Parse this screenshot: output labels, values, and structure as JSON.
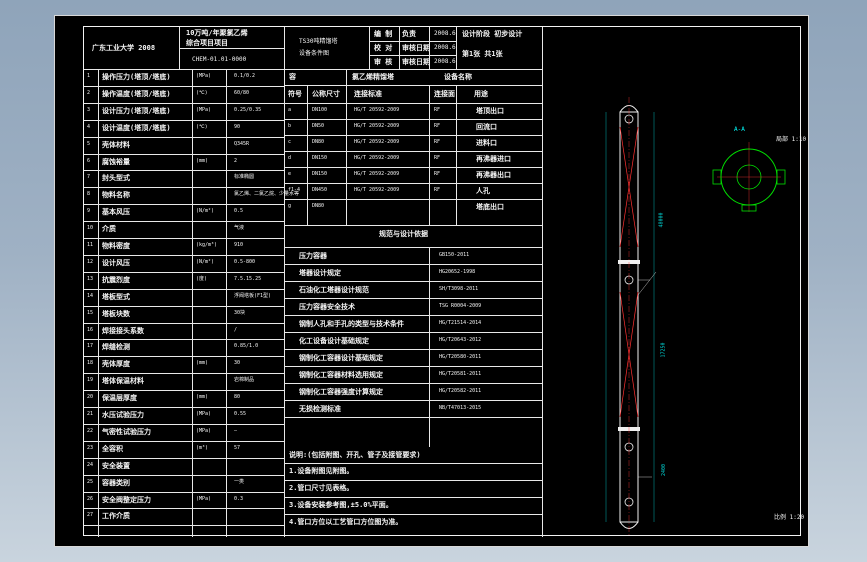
{
  "title_block": {
    "org": "广东工业大学 2008",
    "project_l1": "10万吨/年聚氯乙烯",
    "project_l2": "综合项目项目",
    "code": "CHEM-01.01-0000",
    "drawing_l1": "TS30吨精馏塔",
    "drawing_l2": "设备条件图",
    "roles": [
      {
        "role": "编  制",
        "date": "2008.6"
      },
      {
        "role": "校  对",
        "date": "2008.6"
      },
      {
        "role": "审  核",
        "date": "2008.6"
      }
    ],
    "names": [
      "负责",
      "审核日期",
      "审核日期"
    ],
    "stage": "设计阶段  初步设计",
    "scale_label": "比例  1:20",
    "sheet_no": "第1张  共1张"
  },
  "params": {
    "rows": [
      {
        "no": "1",
        "name": "操作压力(塔顶/塔底)",
        "unit": "MPa",
        "val": "0.1/0.2"
      },
      {
        "no": "2",
        "name": "操作温度(塔顶/塔底)",
        "unit": "℃",
        "val": "60/80"
      },
      {
        "no": "3",
        "name": "设计压力(塔顶/塔底)",
        "unit": "MPa",
        "val": "0.25/0.35"
      },
      {
        "no": "4",
        "name": "设计温度(塔顶/塔底)",
        "unit": "℃",
        "val": "90"
      },
      {
        "no": "5",
        "name": "壳体材料",
        "unit": "",
        "val": "Q345R"
      },
      {
        "no": "6",
        "name": "腐蚀裕量",
        "unit": "mm",
        "val": "2"
      },
      {
        "no": "7",
        "name": "封头型式",
        "unit": "",
        "val": "标准椭圆"
      },
      {
        "no": "8",
        "name": "物料名称",
        "unit": "",
        "val": "氯乙烯、二氯乙烷、少量水等"
      },
      {
        "no": "9",
        "name": "基本风压",
        "unit": "N/m²",
        "val": "0.5"
      },
      {
        "no": "10",
        "name": "介质",
        "unit": "",
        "val": "气液"
      },
      {
        "no": "11",
        "name": "物料密度",
        "unit": "kg/m³",
        "val": "910"
      },
      {
        "no": "12",
        "name": "设计风压",
        "unit": "N/m²",
        "val": "0.5-800"
      },
      {
        "no": "13",
        "name": "抗震烈度",
        "unit": "度",
        "val": "7.5.15.25"
      },
      {
        "no": "14",
        "name": "塔板型式",
        "unit": "",
        "val": "浮阀塔板(F1型)"
      },
      {
        "no": "15",
        "name": "塔板块数",
        "unit": "",
        "val": "30块"
      },
      {
        "no": "16",
        "name": "焊接接头系数",
        "unit": "",
        "val": "/"
      },
      {
        "no": "17",
        "name": "焊缝检测",
        "unit": "",
        "val": "0.85/1.0"
      },
      {
        "no": "18",
        "name": "壳体厚度",
        "unit": "mm",
        "val": "30"
      },
      {
        "no": "19",
        "name": "塔体保温材料",
        "unit": "",
        "val": "岩棉制品"
      },
      {
        "no": "20",
        "name": "保温层厚度",
        "unit": "mm",
        "val": "80"
      },
      {
        "no": "21",
        "name": "水压试验压力",
        "unit": "MPa",
        "val": "0.55"
      },
      {
        "no": "22",
        "name": "气密性试验压力",
        "unit": "MPa",
        "val": "—"
      },
      {
        "no": "23",
        "name": "全容积",
        "unit": "m³",
        "val": "57"
      },
      {
        "no": "24",
        "name": "安全装置",
        "unit": "",
        "val": ""
      },
      {
        "no": "25",
        "name": "容器类别",
        "unit": "",
        "val": "一类"
      },
      {
        "no": "26",
        "name": "安全阀整定压力",
        "unit": "MPa",
        "val": "0.3"
      },
      {
        "no": "27",
        "name": "工作介质",
        "unit": "",
        "val": ""
      }
    ]
  },
  "nozzles": {
    "headers": [
      "符号",
      "公称尺寸",
      "连接标准",
      "连接面",
      "用途"
    ],
    "top_label": "设备名称",
    "top_value": "氯乙烯精馏塔",
    "rows": [
      {
        "sym": "a",
        "dn": "DN100",
        "std": "HG/T 20592-2009",
        "face": "RF",
        "use": "塔顶出口"
      },
      {
        "sym": "b",
        "dn": "DN50",
        "std": "HG/T 20592-2009",
        "face": "RF",
        "use": "回流口"
      },
      {
        "sym": "c",
        "dn": "DN80",
        "std": "HG/T 20592-2009",
        "face": "RF",
        "use": "进料口"
      },
      {
        "sym": "d",
        "dn": "DN150",
        "std": "HG/T 20592-2009",
        "face": "RF",
        "use": "再沸器进口"
      },
      {
        "sym": "e",
        "dn": "DN150",
        "std": "HG/T 20592-2009",
        "face": "RF",
        "use": "再沸器出口"
      },
      {
        "sym": "f1-4",
        "dn": "DN450",
        "std": "HG/T 20592-2009",
        "face": "RF",
        "use": "人孔"
      },
      {
        "sym": "g",
        "dn": "DN80",
        "std": "",
        "face": "",
        "use": "塔底出口"
      }
    ]
  },
  "standards": {
    "heading": "规范与设计依据",
    "rows": [
      {
        "name": "压力容器",
        "std": "GB150-2011"
      },
      {
        "name": "塔器设计规定",
        "std": "HG20652-1998"
      },
      {
        "name": "石油化工塔器设计规范",
        "std": "SH/T3098-2011"
      },
      {
        "name": "压力容器安全技术",
        "std": "TSG R0004-2009"
      },
      {
        "name": "钢制人孔和手孔的类型与技术条件",
        "std": "HG/T21514-2014"
      },
      {
        "name": "化工设备设计基础规定",
        "std": "HG/T20643-2012"
      },
      {
        "name": "钢制化工容器设计基础规定",
        "std": "HG/T20580-2011"
      },
      {
        "name": "钢制化工容器材料选用规定",
        "std": "HG/T20581-2011"
      },
      {
        "name": "钢制化工容器强度计算规定",
        "std": "HG/T20582-2011"
      },
      {
        "name": "无损检测标准",
        "std": "NB/T47013-2015"
      }
    ]
  },
  "notes": {
    "heading": "说明:(包括附图、开孔、管子及接管要求)",
    "items": [
      "1.设备附图见附图。",
      "2.管口尺寸见表格。",
      "3.设备安装参考图,±5.0%平面。",
      "4.管口方位以工艺管口方位图为准。"
    ]
  },
  "drawing": {
    "section_label": "A-A",
    "scale": "比例 1:20",
    "detail_label": "局部 1:10",
    "dims": [
      "48000",
      "17250",
      "2400"
    ]
  }
}
